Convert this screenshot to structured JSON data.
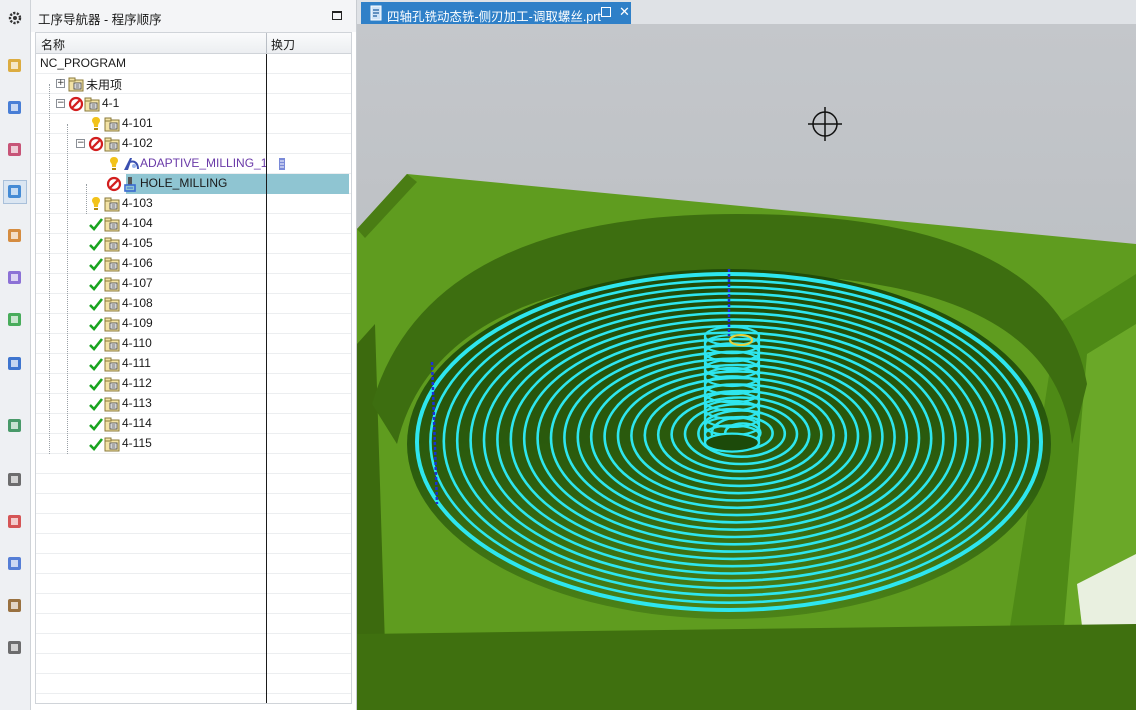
{
  "resource_bar": {
    "icons": [
      "gear-icon",
      "assembly-navigator-icon",
      "constraint-navigator-icon",
      "part-navigator-icon",
      "operation-navigator-icon",
      "machine-tool-icon",
      "feature-navigator-icon",
      "library-icon",
      "info-icon",
      "web-browser-icon",
      "history-icon",
      "roles-icon",
      "system-materials-icon",
      "process-studio-icon",
      "cam-templates-icon"
    ]
  },
  "navigator": {
    "title": "工序导航器 - 程序顺序",
    "columns": {
      "name": "名称",
      "tool_change": "换刀"
    },
    "rows": [
      {
        "label": "NC_PROGRAM",
        "level": 0,
        "status": "none",
        "icon": "none"
      },
      {
        "label": "未用项",
        "level": 1,
        "status": "none",
        "icon": "program-folder",
        "expander": "+"
      },
      {
        "label": "4-1",
        "level": 1,
        "status": "excluded",
        "icon": "program-folder",
        "expander": "-"
      },
      {
        "label": "4-101",
        "level": 2,
        "status": "regenerate",
        "icon": "program-folder"
      },
      {
        "label": "4-102",
        "level": 2,
        "status": "excluded",
        "icon": "program-folder",
        "expander": "-"
      },
      {
        "label": "ADAPTIVE_MILLING_1",
        "level": 3,
        "status": "regenerate",
        "icon": "adaptive-milling-op",
        "purple": true,
        "tool_change": "tool-change-marker"
      },
      {
        "label": "HOLE_MILLING",
        "level": 3,
        "status": "excluded",
        "icon": "hole-milling-op",
        "selected": true
      },
      {
        "label": "4-103",
        "level": 2,
        "status": "regenerate",
        "icon": "program-folder"
      },
      {
        "label": "4-104",
        "level": 2,
        "status": "complete",
        "icon": "program-folder"
      },
      {
        "label": "4-105",
        "level": 2,
        "status": "complete",
        "icon": "program-folder"
      },
      {
        "label": "4-106",
        "level": 2,
        "status": "complete",
        "icon": "program-folder"
      },
      {
        "label": "4-107",
        "level": 2,
        "status": "complete",
        "icon": "program-folder"
      },
      {
        "label": "4-108",
        "level": 2,
        "status": "complete",
        "icon": "program-folder"
      },
      {
        "label": "4-109",
        "level": 2,
        "status": "complete",
        "icon": "program-folder"
      },
      {
        "label": "4-110",
        "level": 2,
        "status": "complete",
        "icon": "program-folder"
      },
      {
        "label": "4-111",
        "level": 2,
        "status": "complete",
        "icon": "program-folder"
      },
      {
        "label": "4-112",
        "level": 2,
        "status": "complete",
        "icon": "program-folder"
      },
      {
        "label": "4-113",
        "level": 2,
        "status": "complete",
        "icon": "program-folder"
      },
      {
        "label": "4-114",
        "level": 2,
        "status": "complete",
        "icon": "program-folder"
      },
      {
        "label": "4-115",
        "level": 2,
        "status": "complete",
        "icon": "program-folder"
      }
    ],
    "empty_rows": 13
  },
  "viewport": {
    "tab_label": "四轴孔铣动态铣-侧刃加工-调取螺丝.prt",
    "colors": {
      "part": "#5e9a1e",
      "part_dark": "#3f6f10",
      "toolpath": "#2ee6ee",
      "background": "#a9adb2"
    }
  }
}
